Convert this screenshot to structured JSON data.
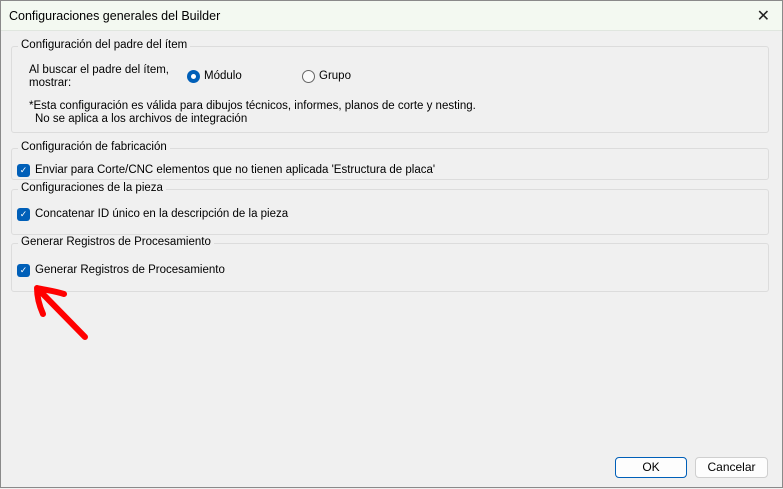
{
  "window": {
    "title": "Configuraciones generales del Builder",
    "close_icon": "close-icon"
  },
  "group_parent": {
    "legend": "Configuración del padre del ítem",
    "prompt_line1": "Al buscar el padre del ítem,",
    "prompt_line2": "mostrar:",
    "options": [
      {
        "label": "Módulo",
        "selected": true
      },
      {
        "label": "Grupo",
        "selected": false
      }
    ],
    "note_line1": "*Esta configuración es válida para dibujos técnicos, informes, planos de corte y nesting.",
    "note_line2": "No se aplica a los archivos de integración"
  },
  "group_fabrication": {
    "legend": "Configuración de fabricación",
    "checkbox": {
      "label": "Enviar para Corte/CNC elementos que no tienen aplicada 'Estructura de placa'",
      "checked": true
    }
  },
  "group_piece": {
    "legend": "Configuraciones de la pieza",
    "checkbox": {
      "label": "Concatenar ID único en la descripción de la pieza",
      "checked": true
    }
  },
  "group_logs": {
    "legend": "Generar Registros de Procesamiento",
    "checkbox": {
      "label": "Generar Registros de Procesamiento",
      "checked": true
    }
  },
  "buttons": {
    "ok": "OK",
    "cancel": "Cancelar"
  },
  "colors": {
    "accent": "#005fb8",
    "annotation": "#ff0000"
  }
}
